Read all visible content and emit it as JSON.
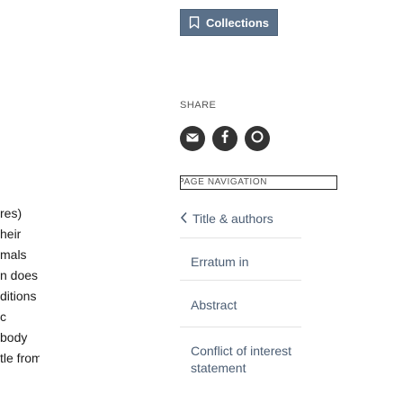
{
  "left_text": {
    "lines": [
      "res)",
      "heir",
      "mals",
      "n does",
      "ditions",
      "c",
      "body",
      "tle from"
    ]
  },
  "sidebar": {
    "collections_label": "Collections",
    "share_label": "SHARE",
    "share_icons": [
      "email-icon",
      "facebook-icon",
      "twitter-icon"
    ],
    "page_nav_label": "PAGE NAVIGATION",
    "nav_items": {
      "title_authors": "Title & authors",
      "erratum": "Erratum in",
      "abstract": "Abstract",
      "conflict_line1": "Conflict of interest",
      "conflict_line2": "statement"
    }
  },
  "colors": {
    "collections_bg": "#5a7089",
    "nav_link": "#4b5d73",
    "share_icon_bg": "#333333"
  }
}
